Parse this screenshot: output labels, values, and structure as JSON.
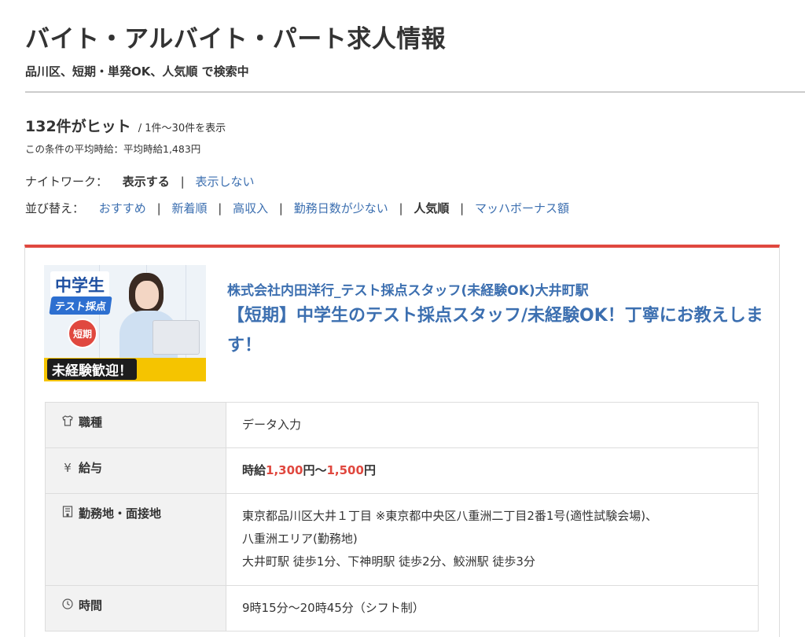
{
  "header": {
    "title": "バイト・アルバイト・パート求人情報",
    "search_summary": "品川区、短期・単発OK、人気順 で検索中"
  },
  "results": {
    "hit_count": "132件がヒット",
    "range": "/ 1件〜30件を表示",
    "avg_wage": "この条件の平均時給：平均時給1,483円"
  },
  "night_work": {
    "label": "ナイトワーク：",
    "options": [
      "表示する",
      "表示しない"
    ],
    "active": "表示する"
  },
  "sort": {
    "label": "並び替え：",
    "options": [
      "おすすめ",
      "新着順",
      "高収入",
      "勤務日数が少ない",
      "人気順",
      "マッハボーナス額"
    ],
    "active": "人気順"
  },
  "job": {
    "thumbnail": {
      "badge1": "中学生",
      "badge2": "テスト採点",
      "short": "短期",
      "bottom": "未経験歓迎！"
    },
    "company": "株式会社内田洋行_テスト採点スタッフ(未経験OK)大井町駅",
    "title": "【短期】中学生のテスト採点スタッフ/未経験OK！丁寧にお教えします！",
    "rows": {
      "category": {
        "label": "職種",
        "value": "データ入力",
        "icon": "shirt-icon"
      },
      "salary": {
        "label": "給与",
        "icon": "yen-icon",
        "prefix": "時給",
        "min": "1,300",
        "mid": "円〜",
        "max": "1,500",
        "suffix": "円"
      },
      "location": {
        "label": "勤務地・面接地",
        "icon": "building-icon",
        "line1": "東京都品川区大井１丁目 ※東京都中央区八重洲二丁目2番1号(適性試験会場)、",
        "line2": "八重洲エリア(勤務地)",
        "line3": "大井町駅 徒歩1分、下神明駅 徒歩2分、鮫洲駅 徒歩3分"
      },
      "hours": {
        "label": "時間",
        "value": "9時15分〜20時45分（シフト制）",
        "icon": "clock-icon"
      }
    }
  },
  "colors": {
    "accent_red": "#e0483f",
    "link_blue": "#3c6fb0"
  }
}
